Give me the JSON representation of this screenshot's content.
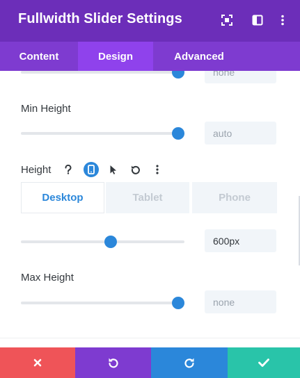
{
  "header": {
    "title": "Fullwidth Slider Settings",
    "icons": [
      "expand-icon",
      "sidebar-toggle-icon",
      "more-vertical-icon"
    ]
  },
  "tabs": [
    {
      "label": "Content",
      "active": false
    },
    {
      "label": "Design",
      "active": true
    },
    {
      "label": "Advanced",
      "active": false
    }
  ],
  "fields": {
    "partial_value": "none",
    "min_height": {
      "label": "Min Height",
      "value": "auto",
      "slider_level": 1.0
    },
    "height": {
      "label": "Height",
      "icons": [
        "help-icon",
        "mobile-responsive-icon",
        "cursor-hover-icon",
        "reset-icon",
        "more-vertical-icon"
      ],
      "devices": [
        {
          "label": "Desktop",
          "active": true
        },
        {
          "label": "Tablet",
          "active": false
        },
        {
          "label": "Phone",
          "active": false
        }
      ],
      "value": "600px",
      "slider_level": 0.55
    },
    "max_height": {
      "label": "Max Height",
      "value": "none",
      "slider_level": 1.0
    }
  },
  "footer": {
    "buttons": [
      {
        "name": "cancel",
        "icon": "close-icon",
        "color": "#ef5458"
      },
      {
        "name": "undo",
        "icon": "undo-icon",
        "color": "#7e3bd0"
      },
      {
        "name": "redo",
        "icon": "redo-icon",
        "color": "#2b87da"
      },
      {
        "name": "save",
        "icon": "check-icon",
        "color": "#29c4a9"
      }
    ]
  },
  "colors": {
    "header_bg": "#6c2eb9",
    "tabs_bg": "#7e3bd0",
    "active_tab_bg": "#8f42ec",
    "accent_blue": "#2b87da"
  }
}
